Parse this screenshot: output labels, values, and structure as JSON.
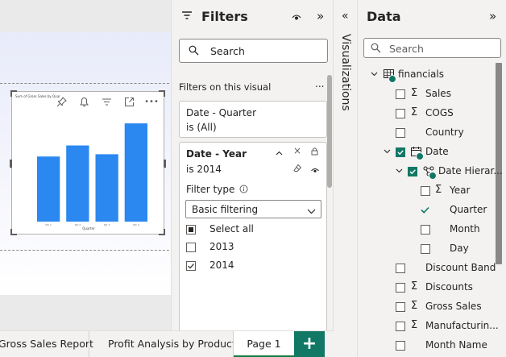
{
  "report": {
    "pages": [
      {
        "label": "Gross Sales Report"
      },
      {
        "label": "Profit Analysis by Product"
      },
      {
        "label": "Page 1"
      }
    ],
    "add_page_label": "+"
  },
  "visual": {
    "title": "Sum of Gross Sales by Quar",
    "x_label": "Quarter"
  },
  "chart_data": {
    "type": "bar",
    "title": "Sum of Gross Sales by Quar",
    "xlabel": "Quarter",
    "categories": [
      "Qtr 1",
      "Qtr 2",
      "Qtr 3",
      "Qtr 4"
    ],
    "values": [
      0.59,
      0.69,
      0.61,
      0.89
    ],
    "ylim": [
      0,
      1
    ],
    "color": "#2b88f0",
    "grid": false
  },
  "filters": {
    "title": "Filters",
    "search_placeholder": "Search",
    "section_title": "Filters on this visual",
    "more": "...",
    "cards": [
      {
        "title": "Date - Quarter",
        "summary": "is (All)"
      },
      {
        "title": "Date - Year",
        "summary": "is 2014",
        "filter_type_label": "Filter type",
        "filter_type_value": "Basic filtering",
        "options": [
          {
            "label": "Select all",
            "state": "partial"
          },
          {
            "label": "2013",
            "state": "unchecked"
          },
          {
            "label": "2014",
            "state": "checked"
          }
        ]
      }
    ]
  },
  "visualizations": {
    "label": "Visualizations",
    "collapse": "«"
  },
  "data_pane": {
    "title": "Data",
    "collapse": "»",
    "search_placeholder": "Search",
    "tree": [
      {
        "label": "financials"
      },
      {
        "label": "Sales"
      },
      {
        "label": "COGS"
      },
      {
        "label": "Country"
      },
      {
        "label": "Date"
      },
      {
        "label": "Date Hierar..."
      },
      {
        "label": "Year"
      },
      {
        "label": "Quarter"
      },
      {
        "label": "Month"
      },
      {
        "label": "Day"
      },
      {
        "label": "Discount Band"
      },
      {
        "label": "Discounts"
      },
      {
        "label": "Gross Sales"
      },
      {
        "label": "Manufacturin..."
      },
      {
        "label": "Month Name"
      }
    ]
  },
  "colors": {
    "accent": "#117865",
    "bar": "#2b88f0",
    "active_tab_underline": "#107c41"
  }
}
